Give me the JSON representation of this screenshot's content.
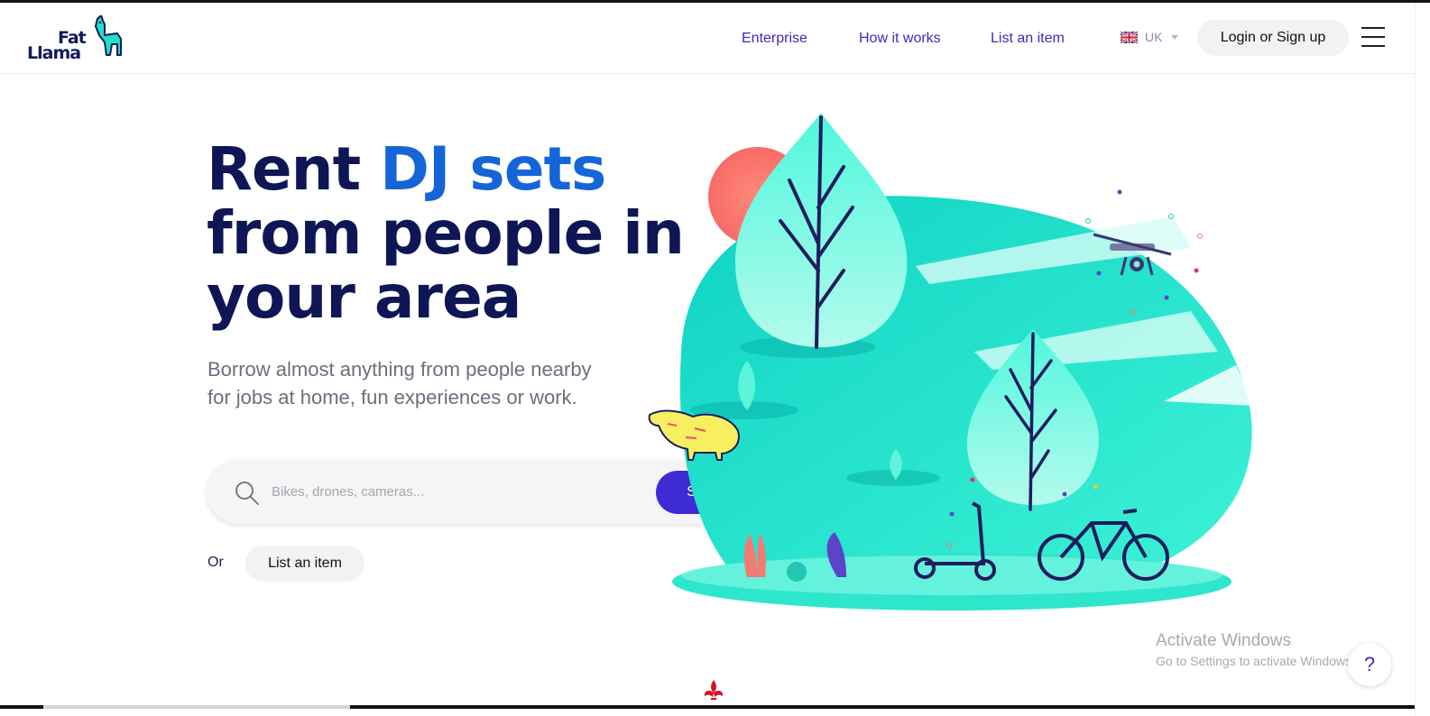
{
  "brand": {
    "line1": "Fat",
    "line2": "Llama"
  },
  "nav": {
    "links": [
      "Enterprise",
      "How it works",
      "List an item"
    ],
    "locale": "UK",
    "locale_icon": "uk-flag-icon",
    "login_label": "Login or Sign up",
    "menu_icon": "hamburger-menu-icon"
  },
  "hero": {
    "title_prefix": "Rent ",
    "title_accent": "DJ sets",
    "title_line2": "from people in",
    "title_line3": "your area",
    "subtitle_line1": "Borrow almost anything from people nearby",
    "subtitle_line2": "for jobs at home, fun experiences or work."
  },
  "search": {
    "placeholder": "Bikes, drones, cameras...",
    "value": "",
    "button_label": "Search"
  },
  "cta": {
    "or_label": "Or",
    "list_label": "List an item"
  },
  "watermark": {
    "title": "Activate Windows",
    "subtitle": "Go to Settings to activate Windows."
  },
  "help": {
    "label": "?"
  },
  "colors": {
    "navy": "#0e1656",
    "accent_blue": "#1565d8",
    "primary_purple": "#3e2bd4",
    "teal": "#21e6c8"
  }
}
